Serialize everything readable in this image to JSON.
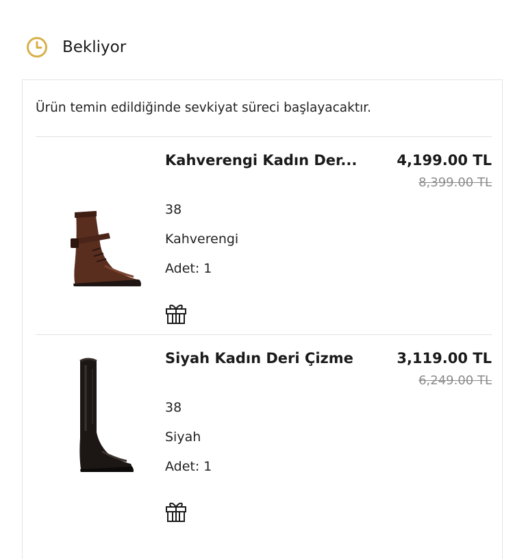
{
  "status": {
    "label": "Bekliyor",
    "icon": "clock-icon",
    "icon_color": "#d8b04a"
  },
  "card": {
    "note": "Ürün temin edildiğinde sevkiyat süreci başlayacaktır."
  },
  "products": [
    {
      "name": "Kahverengi Kadın Der...",
      "price": "4,199.00 TL",
      "old_price": "8,399.00 TL",
      "size": "38",
      "color": "Kahverengi",
      "quantity": "Adet: 1",
      "image_icon": "brown-ankle-boot-image",
      "gift_icon": "gift-icon"
    },
    {
      "name": "Siyah Kadın Deri Çizme",
      "price": "3,119.00 TL",
      "old_price": "6,249.00 TL",
      "size": "38",
      "color": "Siyah",
      "quantity": "Adet: 1",
      "image_icon": "black-tall-boot-image",
      "gift_icon": "gift-icon"
    }
  ]
}
